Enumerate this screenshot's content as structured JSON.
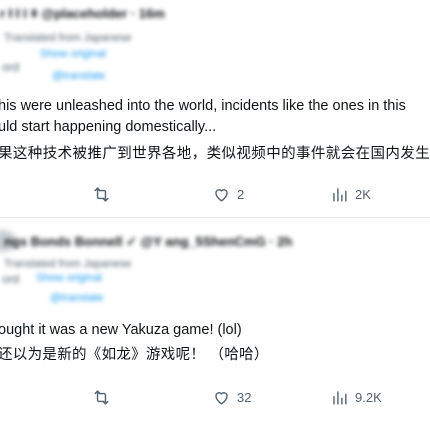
{
  "post1": {
    "header_blur": "r ł ł I ǂ  @placeholder · 16m",
    "translated_blur": "Translated from Japanese",
    "handle_blur": "Show original",
    "small_blur": "ord",
    "tag_blur": "@translate",
    "text_en_line1": "his were unleashed into the world, incidents like the ones in this",
    "text_en_line2": "uld start happening domestically...",
    "text_zh": "果这种技术被推广到世界各地，类似视频中的事件就会在国内发生。",
    "actions": {
      "reply_count": "",
      "retweet_count": "",
      "like_count": "2",
      "views_count": "2K"
    }
  },
  "post2": {
    "header_blur": "ngs Bonds Bonnell ✓ @Y ang_5ShenCmG · 2h",
    "translated_blur": "Translated from Japanese",
    "small_blur": "ord",
    "handle_blur": "Show original",
    "tag_blur": "@translate",
    "text_en": "ought it was a new Yakuza game! (lol)",
    "text_zh": "还以为是新的《如龙》游戏呢！ （哈哈）",
    "actions": {
      "reply_count": "",
      "retweet_count": "",
      "like_count": "32",
      "views_count": "9.2K"
    }
  },
  "colors": {
    "text": "#0f1419",
    "muted": "#536471",
    "link": "#1d9bf0",
    "divider": "#e6ecf0"
  },
  "icons": [
    "reply-icon",
    "retweet-icon",
    "like-icon",
    "views-icon"
  ]
}
